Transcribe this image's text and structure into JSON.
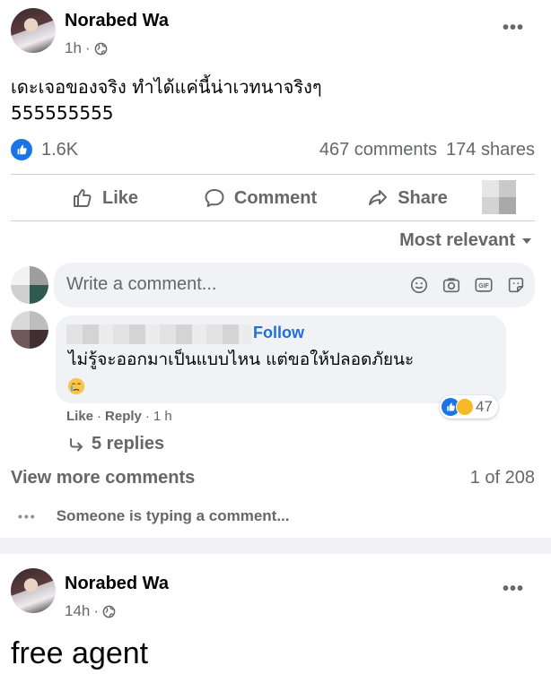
{
  "post1": {
    "author": "Norabed Wa",
    "time": "1h",
    "more": "•••",
    "text_line1": "เดะเจอของจริง ทำได้แค่นี้น่าเวทนาจริงๆ",
    "text_line2": "555555555",
    "reactions_count": "1.6K",
    "comments_count": "467 comments",
    "shares_count": "174 shares",
    "actions": {
      "like": "Like",
      "comment": "Comment",
      "share": "Share"
    }
  },
  "comments": {
    "sort_label": "Most relevant",
    "input_placeholder": "Write a comment...",
    "comment": {
      "follow_label": "Follow",
      "text": "ไม่รู้จะออกมาเป็นแบบไหน แต่ขอให้ปลอดภัยนะ",
      "reactions": "47",
      "like_label": "Like",
      "reply_label": "Reply",
      "time": "1 h",
      "replies_label": "5 replies"
    },
    "view_more_label": "View more comments",
    "page_count": "1 of 208",
    "typing_text": "Someone is typing a comment..."
  },
  "post2": {
    "author": "Norabed Wa",
    "time": "14h",
    "more": "•••",
    "text": "free agent"
  },
  "colors": {
    "accent": "#216fdb",
    "like_blue": "#1b74e4",
    "muted": "#65676b",
    "bg": "#f0f2f5"
  },
  "icons": [
    "globe-icon",
    "like-icon",
    "comment-icon",
    "share-icon",
    "caret-down-icon",
    "smile-icon",
    "camera-icon",
    "gif-icon",
    "sticker-icon",
    "reply-arrow-icon",
    "crying-emoji-icon"
  ]
}
